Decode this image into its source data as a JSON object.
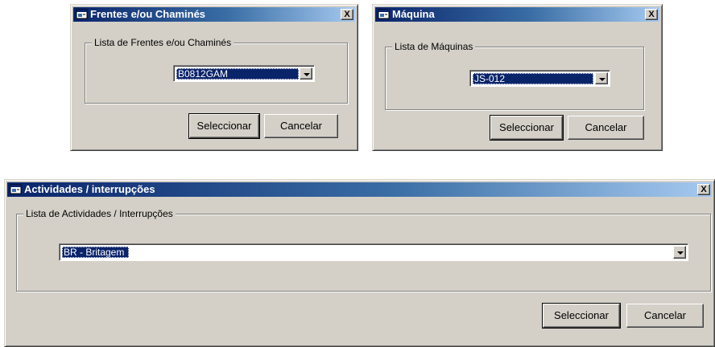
{
  "dialog_frentes": {
    "title": "Frentes e/ou Chaminés",
    "close_label": "X",
    "group_label": "Lista de Frentes e/ou Chaminés",
    "selected_value": "B0812GAM",
    "select_button": "Seleccionar",
    "cancel_button": "Cancelar"
  },
  "dialog_maquina": {
    "title": "Máquina",
    "close_label": "X",
    "group_label": "Lista de Máquinas",
    "selected_value": "JS-012",
    "select_button": "Seleccionar",
    "cancel_button": "Cancelar"
  },
  "dialog_actividades": {
    "title": "Actividades / interrupções",
    "close_label": "X",
    "group_label": "Lista de Actividades / Interrupções",
    "selected_value": "BR - Britagem",
    "select_button": "Seleccionar",
    "cancel_button": "Cancelar"
  },
  "colors": {
    "dialog_face": "#d4d0c8",
    "title_active": "#0a246a",
    "title_gradient_end": "#a6caf0",
    "selection": "#0a246a"
  },
  "icons": {
    "title_icon": "app-window-icon",
    "dropdown": "chevron-down-icon"
  }
}
